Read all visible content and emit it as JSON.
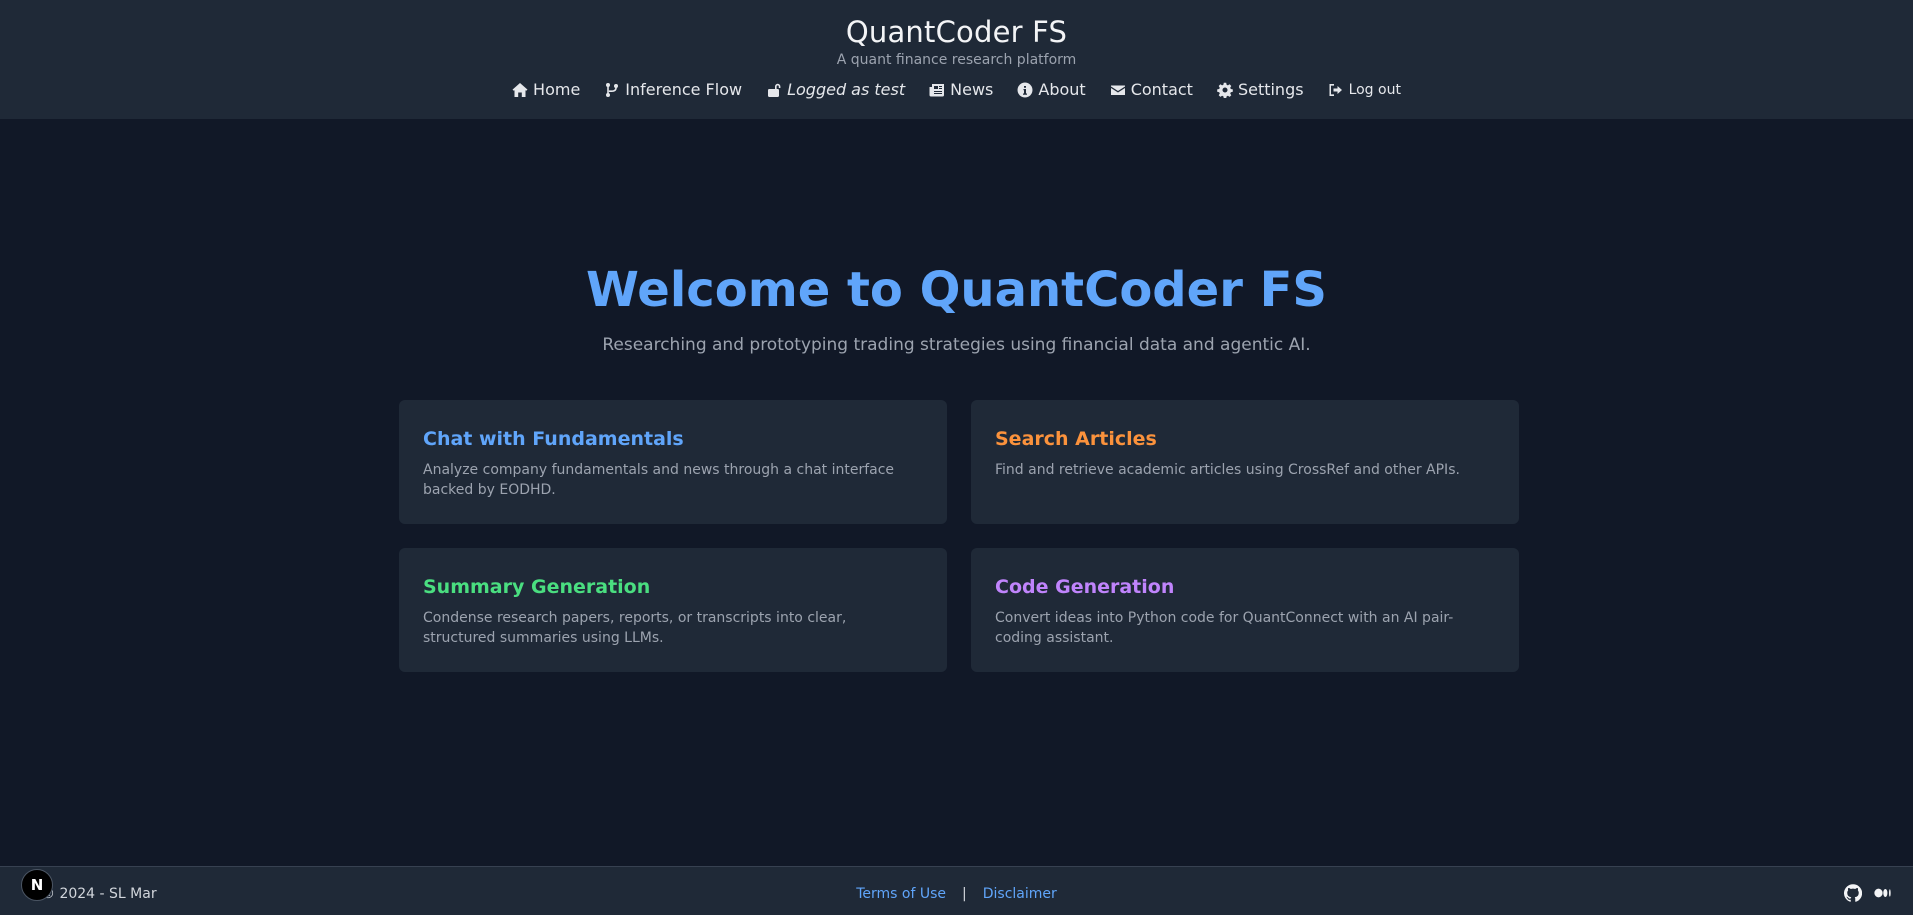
{
  "header": {
    "title": "QuantCoder FS",
    "subtitle": "A quant finance research platform"
  },
  "nav": {
    "home": "Home",
    "inference_flow": "Inference Flow",
    "logged_as": "Logged as test",
    "news": "News",
    "about": "About",
    "contact": "Contact",
    "settings": "Settings",
    "logout": "Log out"
  },
  "hero": {
    "title": "Welcome to QuantCoder FS",
    "subtitle": "Researching and prototyping trading strategies using financial data and agentic AI."
  },
  "cards": [
    {
      "title": "Chat with Fundamentals",
      "description": "Analyze company fundamentals and news through a chat interface backed by EODHD.",
      "color": "#60a5fa"
    },
    {
      "title": "Search Articles",
      "description": "Find and retrieve academic articles using CrossRef and other APIs.",
      "color": "#fb923c"
    },
    {
      "title": "Summary Generation",
      "description": "Condense research papers, reports, or transcripts into clear, structured summaries using LLMs.",
      "color": "#4ade80"
    },
    {
      "title": "Code Generation",
      "description": "Convert ideas into Python code for QuantConnect with an AI pair-coding assistant.",
      "color": "#c084fc"
    }
  ],
  "footer": {
    "copyright": "© 2024 - SL Mar",
    "terms": "Terms of Use",
    "separator": "|",
    "disclaimer": "Disclaimer"
  },
  "badge": "N",
  "icons": [
    "home-icon",
    "git-branch-icon",
    "unlock-icon",
    "newspaper-icon",
    "info-icon",
    "envelope-icon",
    "gear-icon",
    "sign-out-icon",
    "github-icon",
    "medium-icon"
  ]
}
